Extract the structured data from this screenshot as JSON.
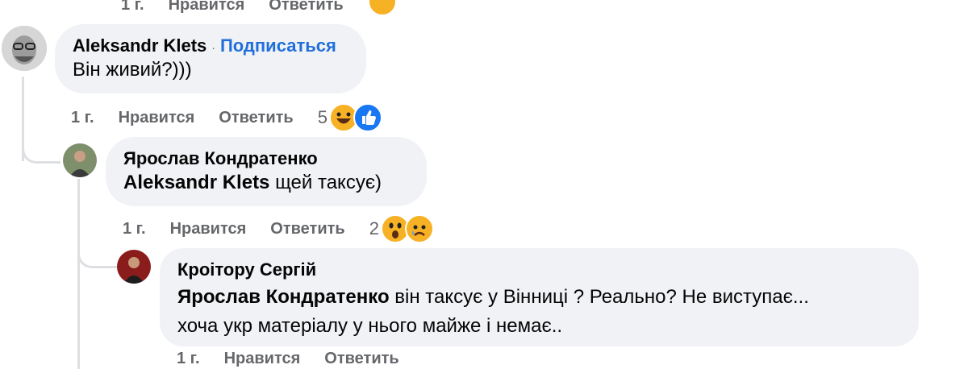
{
  "top_actions": {
    "time": "1 г.",
    "like": "Нравится",
    "reply": "Ответить"
  },
  "comments": [
    {
      "author": "Aleksandr Klets",
      "subscribe": "Подписаться",
      "text": "Він живий?)))",
      "time": "1 г.",
      "like": "Нравится",
      "reply": "Ответить",
      "reactions_count": "5",
      "reactions": [
        "haha-icon",
        "like-icon"
      ]
    },
    {
      "author": "Ярослав Кондратенко",
      "mention": "Aleksandr Klets",
      "text": " щей таксує)",
      "time": "1 г.",
      "like": "Нравится",
      "reply": "Ответить",
      "reactions_count": "2",
      "reactions": [
        "wow-icon",
        "sad-icon"
      ]
    },
    {
      "author": "Кроітору Сергій",
      "mention": "Ярослав Кондратенко",
      "text_line1": " він таксує у Вінниці ? Реально? Не виступає...",
      "text_line2": "хоча укр матеріалу у нього майже і немає..",
      "time": "1 г.",
      "like": "Нравится",
      "reply": "Ответить"
    }
  ],
  "colors": {
    "bubble": "#f0f2f5",
    "link": "#216fdb",
    "secondary_text": "#65676b",
    "thread_line": "#dddfe2"
  }
}
